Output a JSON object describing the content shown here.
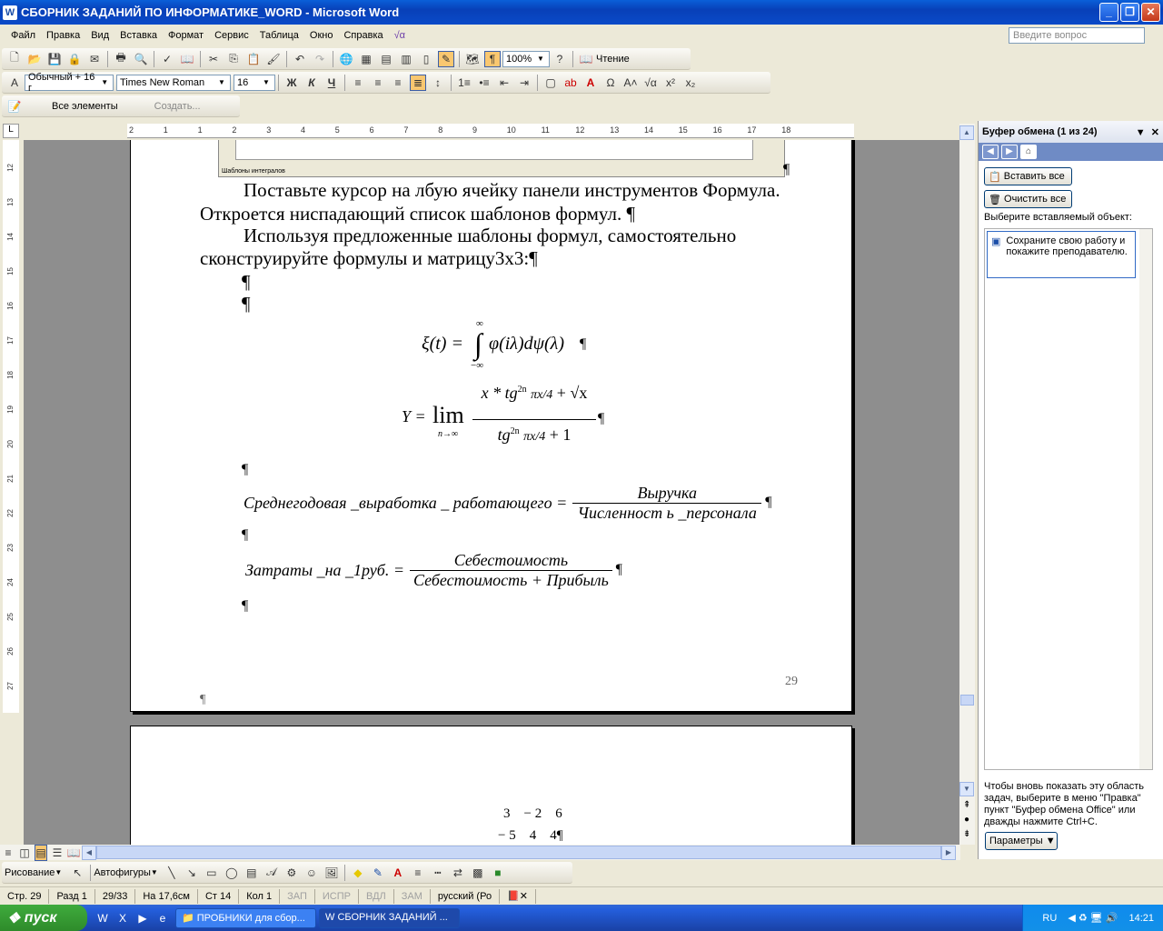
{
  "window": {
    "title": "СБОРНИК ЗАДАНИЙ ПО ИНФОРМАТИКЕ_WORD - Microsoft Word"
  },
  "menu": {
    "items": [
      "Файл",
      "Правка",
      "Вид",
      "Вставка",
      "Формат",
      "Сервис",
      "Таблица",
      "Окно",
      "Справка"
    ],
    "ask_placeholder": "Введите вопрос"
  },
  "toolbar": {
    "zoom": "100%",
    "reading": "Чтение"
  },
  "formatting": {
    "style": "Обычный + 16 г",
    "font": "Times New Roman",
    "size": "16"
  },
  "styles_bar": {
    "all_elements": "Все элементы",
    "create": "Создать..."
  },
  "ruler": {
    "h_ticks": [
      "2",
      "1",
      "1",
      "2",
      "3",
      "4",
      "5",
      "6",
      "7",
      "8",
      "9",
      "10",
      "11",
      "12",
      "13",
      "14",
      "15",
      "16",
      "17",
      "18"
    ],
    "v_ticks": [
      "12",
      "13",
      "14",
      "15",
      "16",
      "17",
      "18",
      "19",
      "20",
      "21",
      "22",
      "23",
      "24",
      "25",
      "26",
      "27"
    ]
  },
  "document": {
    "embedded_caption": "Шаблоны интегралов",
    "para1_line1": "Поставьте курсор на лбую ячейку панели инструментов Формула.",
    "para1_line2": "Откроется ниспадающий список шаблонов формул. ¶",
    "para2_line1": "Используя предложенные шаблоны формул, самостоятельно",
    "para2_line2": "сконструируйте формулы и матрицу3х3:¶",
    "pilcrow": "¶",
    "eq3_lhs": "Среднегодовая _выработка _ работающего =",
    "eq3_num": "Выручка",
    "eq3_den": "Численност ь _персонала",
    "eq4_lhs": "Затраты _на _1руб. =",
    "eq4_num": "Себестоимость",
    "eq4_den": "Себестоимость + Прибыль",
    "page_number": "29",
    "matrix_row1": "3    − 2    6",
    "matrix_row2": "− 5    4    4¶"
  },
  "taskpane": {
    "title": "Буфер обмена (1 из 24)",
    "paste_all": "Вставить все",
    "clear_all": "Очистить все",
    "choose_label": "Выберите вставляемый объект:",
    "clip_item": "Сохраните свою работу и покажите преподавателю.",
    "hint": "Чтобы вновь показать эту область задач, выберите в меню \"Правка\" пункт \"Буфер обмена Office\" или дважды нажмите Ctrl+C.",
    "options": "Параметры"
  },
  "drawing": {
    "draw": "Рисование",
    "autoshapes": "Автофигуры"
  },
  "status": {
    "page": "Стр. 29",
    "section": "Разд 1",
    "pages": "29/33",
    "at": "На 17,6см",
    "line": "Ст 14",
    "col": "Кол 1",
    "rec": "ЗАП",
    "trk": "ИСПР",
    "ext": "ВДЛ",
    "ovr": "ЗАМ",
    "lang": "русский (Ро"
  },
  "taskbar": {
    "start": "пуск",
    "item1": "ПРОБНИКИ для сбор...",
    "item2": "СБОРНИК ЗАДАНИЙ ...",
    "lang": "RU",
    "clock": "14:21"
  }
}
